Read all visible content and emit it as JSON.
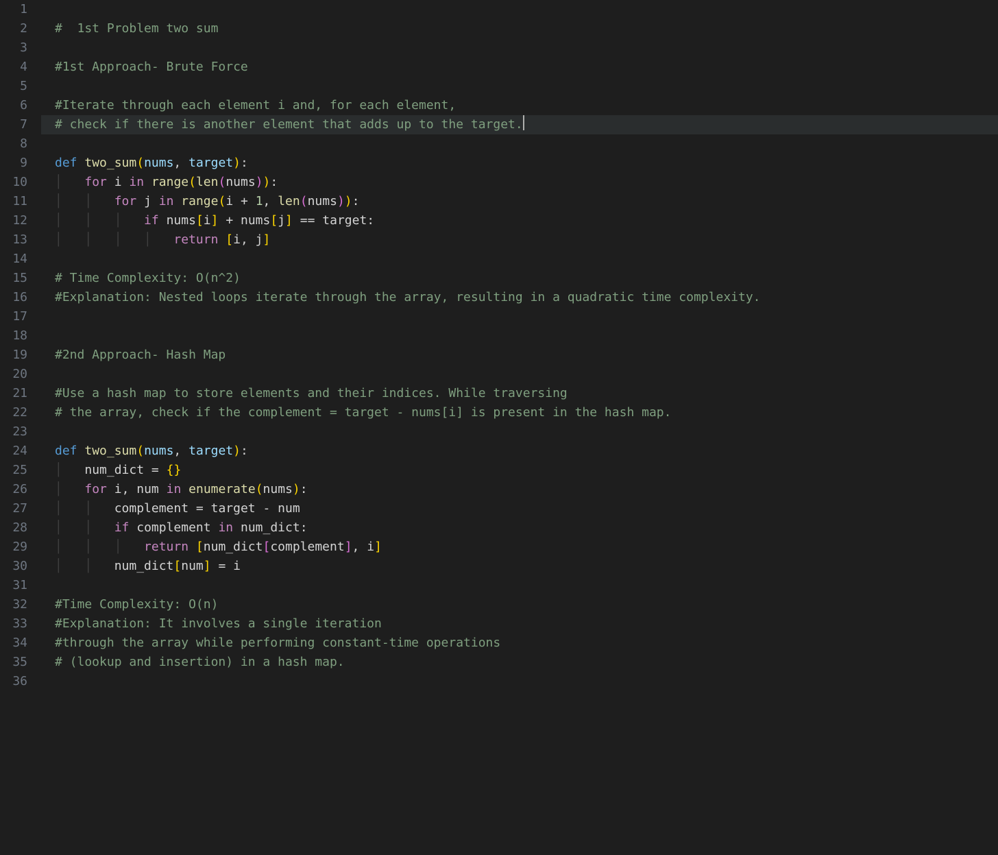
{
  "editor": {
    "highlighted_line": 7,
    "line_count": 36,
    "lines": [
      {
        "n": 1,
        "tokens": []
      },
      {
        "n": 2,
        "tokens": [
          {
            "t": "#  1st Problem two sum",
            "c": "comment"
          }
        ]
      },
      {
        "n": 3,
        "tokens": []
      },
      {
        "n": 4,
        "tokens": [
          {
            "t": "#1st Approach- Brute Force",
            "c": "comment"
          }
        ]
      },
      {
        "n": 5,
        "tokens": []
      },
      {
        "n": 6,
        "tokens": [
          {
            "t": "#Iterate through each element i and, for each element,",
            "c": "comment"
          }
        ]
      },
      {
        "n": 7,
        "tokens": [
          {
            "t": "# check if there is another element that adds up to the target.",
            "c": "comment"
          }
        ],
        "cursor_after": true
      },
      {
        "n": 8,
        "tokens": []
      },
      {
        "n": 9,
        "tokens": [
          {
            "t": "def",
            "c": "keyword"
          },
          {
            "t": " "
          },
          {
            "t": "two_sum",
            "c": "funcname"
          },
          {
            "t": "(",
            "c": "paren"
          },
          {
            "t": "nums",
            "c": "param"
          },
          {
            "t": ",",
            "c": "punct"
          },
          {
            "t": " "
          },
          {
            "t": "target",
            "c": "param"
          },
          {
            "t": ")",
            "c": "paren"
          },
          {
            "t": ":",
            "c": "punct"
          }
        ]
      },
      {
        "n": 10,
        "tokens": [
          {
            "t": "│   ",
            "c": "indent-guide"
          },
          {
            "t": "for",
            "c": "control"
          },
          {
            "t": " "
          },
          {
            "t": "i",
            "c": "variable"
          },
          {
            "t": " "
          },
          {
            "t": "in",
            "c": "control"
          },
          {
            "t": " "
          },
          {
            "t": "range",
            "c": "builtin"
          },
          {
            "t": "(",
            "c": "paren"
          },
          {
            "t": "len",
            "c": "builtin"
          },
          {
            "t": "(",
            "c": "paren2"
          },
          {
            "t": "nums",
            "c": "variable"
          },
          {
            "t": ")",
            "c": "paren2"
          },
          {
            "t": ")",
            "c": "paren"
          },
          {
            "t": ":",
            "c": "punct"
          }
        ]
      },
      {
        "n": 11,
        "tokens": [
          {
            "t": "│   │   ",
            "c": "indent-guide"
          },
          {
            "t": "for",
            "c": "control"
          },
          {
            "t": " "
          },
          {
            "t": "j",
            "c": "variable"
          },
          {
            "t": " "
          },
          {
            "t": "in",
            "c": "control"
          },
          {
            "t": " "
          },
          {
            "t": "range",
            "c": "builtin"
          },
          {
            "t": "(",
            "c": "paren"
          },
          {
            "t": "i",
            "c": "variable"
          },
          {
            "t": " "
          },
          {
            "t": "+",
            "c": "operator"
          },
          {
            "t": " "
          },
          {
            "t": "1",
            "c": "number"
          },
          {
            "t": ",",
            "c": "punct"
          },
          {
            "t": " "
          },
          {
            "t": "len",
            "c": "builtin"
          },
          {
            "t": "(",
            "c": "paren2"
          },
          {
            "t": "nums",
            "c": "variable"
          },
          {
            "t": ")",
            "c": "paren2"
          },
          {
            "t": ")",
            "c": "paren"
          },
          {
            "t": ":",
            "c": "punct"
          }
        ]
      },
      {
        "n": 12,
        "tokens": [
          {
            "t": "│   │   │   ",
            "c": "indent-guide"
          },
          {
            "t": "if",
            "c": "control"
          },
          {
            "t": " "
          },
          {
            "t": "nums",
            "c": "variable"
          },
          {
            "t": "[",
            "c": "paren"
          },
          {
            "t": "i",
            "c": "variable"
          },
          {
            "t": "]",
            "c": "paren"
          },
          {
            "t": " "
          },
          {
            "t": "+",
            "c": "operator"
          },
          {
            "t": " "
          },
          {
            "t": "nums",
            "c": "variable"
          },
          {
            "t": "[",
            "c": "paren"
          },
          {
            "t": "j",
            "c": "variable"
          },
          {
            "t": "]",
            "c": "paren"
          },
          {
            "t": " "
          },
          {
            "t": "==",
            "c": "operator"
          },
          {
            "t": " "
          },
          {
            "t": "target",
            "c": "variable"
          },
          {
            "t": ":",
            "c": "punct"
          }
        ]
      },
      {
        "n": 13,
        "tokens": [
          {
            "t": "│   │   │   │   ",
            "c": "indent-guide"
          },
          {
            "t": "return",
            "c": "control"
          },
          {
            "t": " "
          },
          {
            "t": "[",
            "c": "paren"
          },
          {
            "t": "i",
            "c": "variable"
          },
          {
            "t": ",",
            "c": "punct"
          },
          {
            "t": " "
          },
          {
            "t": "j",
            "c": "variable"
          },
          {
            "t": "]",
            "c": "paren"
          }
        ]
      },
      {
        "n": 14,
        "tokens": []
      },
      {
        "n": 15,
        "tokens": [
          {
            "t": "# Time Complexity: O(n^2)",
            "c": "comment"
          }
        ]
      },
      {
        "n": 16,
        "tokens": [
          {
            "t": "#Explanation: Nested loops iterate through the array, resulting in a quadratic time complexity.",
            "c": "comment"
          }
        ]
      },
      {
        "n": 17,
        "tokens": []
      },
      {
        "n": 18,
        "tokens": []
      },
      {
        "n": 19,
        "tokens": [
          {
            "t": "#2nd Approach- Hash Map",
            "c": "comment"
          }
        ]
      },
      {
        "n": 20,
        "tokens": []
      },
      {
        "n": 21,
        "tokens": [
          {
            "t": "#Use a hash map to store elements and their indices. While traversing",
            "c": "comment"
          }
        ]
      },
      {
        "n": 22,
        "tokens": [
          {
            "t": "# the array, check if the complement = target - nums[i] is present in the hash map.",
            "c": "comment"
          }
        ]
      },
      {
        "n": 23,
        "tokens": []
      },
      {
        "n": 24,
        "tokens": [
          {
            "t": "def",
            "c": "keyword"
          },
          {
            "t": " "
          },
          {
            "t": "two_sum",
            "c": "funcname"
          },
          {
            "t": "(",
            "c": "paren"
          },
          {
            "t": "nums",
            "c": "param"
          },
          {
            "t": ",",
            "c": "punct"
          },
          {
            "t": " "
          },
          {
            "t": "target",
            "c": "param"
          },
          {
            "t": ")",
            "c": "paren"
          },
          {
            "t": ":",
            "c": "punct"
          }
        ]
      },
      {
        "n": 25,
        "tokens": [
          {
            "t": "│   ",
            "c": "indent-guide"
          },
          {
            "t": "num_dict",
            "c": "variable"
          },
          {
            "t": " "
          },
          {
            "t": "=",
            "c": "operator"
          },
          {
            "t": " "
          },
          {
            "t": "{",
            "c": "paren"
          },
          {
            "t": "}",
            "c": "paren"
          }
        ]
      },
      {
        "n": 26,
        "tokens": [
          {
            "t": "│   ",
            "c": "indent-guide"
          },
          {
            "t": "for",
            "c": "control"
          },
          {
            "t": " "
          },
          {
            "t": "i",
            "c": "variable"
          },
          {
            "t": ",",
            "c": "punct"
          },
          {
            "t": " "
          },
          {
            "t": "num",
            "c": "variable"
          },
          {
            "t": " "
          },
          {
            "t": "in",
            "c": "control"
          },
          {
            "t": " "
          },
          {
            "t": "enumerate",
            "c": "builtin"
          },
          {
            "t": "(",
            "c": "paren"
          },
          {
            "t": "nums",
            "c": "variable"
          },
          {
            "t": ")",
            "c": "paren"
          },
          {
            "t": ":",
            "c": "punct"
          }
        ]
      },
      {
        "n": 27,
        "tokens": [
          {
            "t": "│   │   ",
            "c": "indent-guide"
          },
          {
            "t": "complement",
            "c": "variable"
          },
          {
            "t": " "
          },
          {
            "t": "=",
            "c": "operator"
          },
          {
            "t": " "
          },
          {
            "t": "target",
            "c": "variable"
          },
          {
            "t": " "
          },
          {
            "t": "-",
            "c": "operator"
          },
          {
            "t": " "
          },
          {
            "t": "num",
            "c": "variable"
          }
        ]
      },
      {
        "n": 28,
        "tokens": [
          {
            "t": "│   │   ",
            "c": "indent-guide"
          },
          {
            "t": "if",
            "c": "control"
          },
          {
            "t": " "
          },
          {
            "t": "complement",
            "c": "variable"
          },
          {
            "t": " "
          },
          {
            "t": "in",
            "c": "control"
          },
          {
            "t": " "
          },
          {
            "t": "num_dict",
            "c": "variable"
          },
          {
            "t": ":",
            "c": "punct"
          }
        ]
      },
      {
        "n": 29,
        "tokens": [
          {
            "t": "│   │   │   ",
            "c": "indent-guide"
          },
          {
            "t": "return",
            "c": "control"
          },
          {
            "t": " "
          },
          {
            "t": "[",
            "c": "paren"
          },
          {
            "t": "num_dict",
            "c": "variable"
          },
          {
            "t": "[",
            "c": "paren2"
          },
          {
            "t": "complement",
            "c": "variable"
          },
          {
            "t": "]",
            "c": "paren2"
          },
          {
            "t": ",",
            "c": "punct"
          },
          {
            "t": " "
          },
          {
            "t": "i",
            "c": "variable"
          },
          {
            "t": "]",
            "c": "paren"
          }
        ]
      },
      {
        "n": 30,
        "tokens": [
          {
            "t": "│   │   ",
            "c": "indent-guide"
          },
          {
            "t": "num_dict",
            "c": "variable"
          },
          {
            "t": "[",
            "c": "paren"
          },
          {
            "t": "num",
            "c": "variable"
          },
          {
            "t": "]",
            "c": "paren"
          },
          {
            "t": " "
          },
          {
            "t": "=",
            "c": "operator"
          },
          {
            "t": " "
          },
          {
            "t": "i",
            "c": "variable"
          }
        ]
      },
      {
        "n": 31,
        "tokens": []
      },
      {
        "n": 32,
        "tokens": [
          {
            "t": "#Time Complexity: O(n)",
            "c": "comment"
          }
        ]
      },
      {
        "n": 33,
        "tokens": [
          {
            "t": "#Explanation: It involves a single iteration",
            "c": "comment"
          }
        ]
      },
      {
        "n": 34,
        "tokens": [
          {
            "t": "#through the array while performing constant-time operations",
            "c": "comment"
          }
        ]
      },
      {
        "n": 35,
        "tokens": [
          {
            "t": "# (lookup and insertion) in a hash map.",
            "c": "comment"
          }
        ]
      },
      {
        "n": 36,
        "tokens": []
      }
    ]
  }
}
